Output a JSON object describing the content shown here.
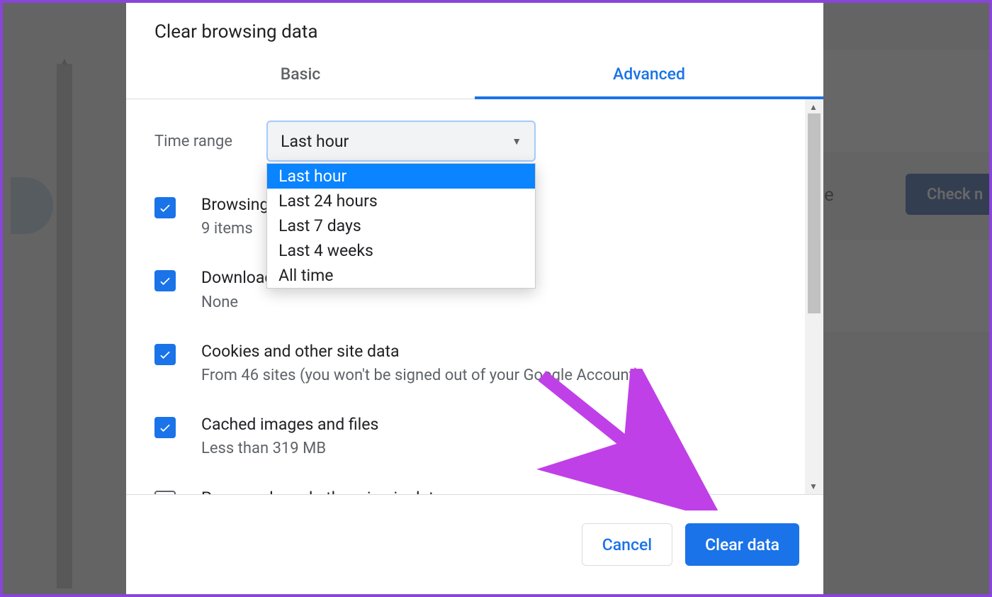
{
  "dialog": {
    "title": "Clear browsing data",
    "tabs": {
      "basic": "Basic",
      "advanced": "Advanced"
    },
    "time_range_label": "Time range",
    "time_range_selected": "Last hour",
    "time_range_options": [
      "Last hour",
      "Last 24 hours",
      "Last 7 days",
      "Last 4 weeks",
      "All time"
    ],
    "items": [
      {
        "title": "Browsing history",
        "title_cut": "Browsin",
        "sub": "9 items",
        "sub_cut": "9 items",
        "checked": true
      },
      {
        "title": "Download history",
        "title_cut": "Downloa",
        "sub": "None",
        "checked": true
      },
      {
        "title": "Cookies and other site data",
        "sub": "From 46 sites (you won't be signed out of your Google Account)",
        "checked": true
      },
      {
        "title": "Cached images and files",
        "sub": "Less than 319 MB",
        "checked": true
      },
      {
        "title": "Passwords and other sign-in data",
        "sub": "",
        "checked": false
      }
    ],
    "cancel": "Cancel",
    "clear": "Clear data"
  },
  "background": {
    "letter": "e",
    "check_btn": "Check n"
  }
}
